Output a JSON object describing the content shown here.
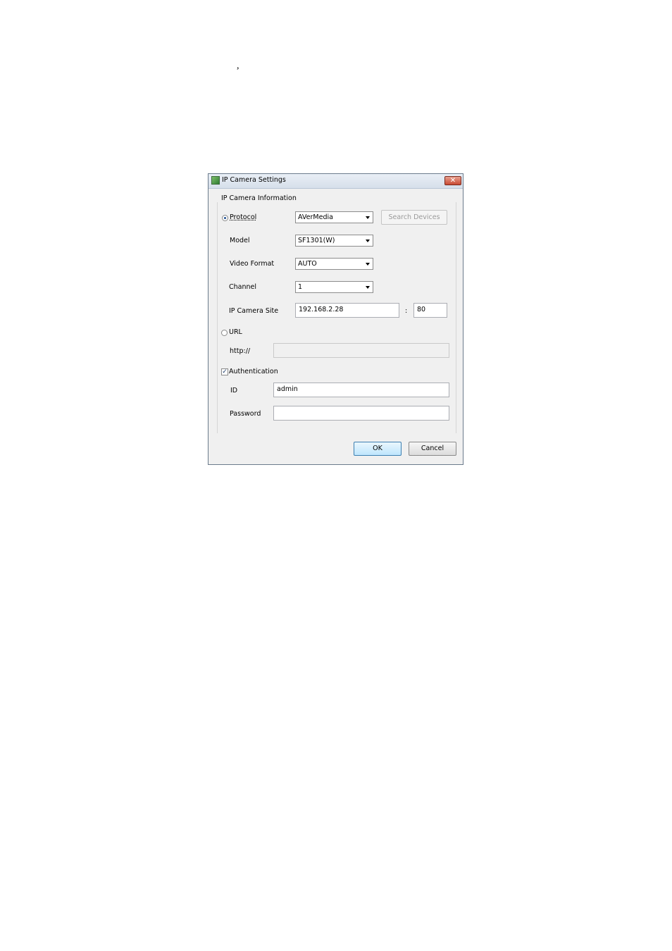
{
  "page": {
    "stray_mark": ","
  },
  "dialog": {
    "title": "IP Camera Settings",
    "close_label": "✕",
    "group_label": "IP Camera Information",
    "protocol": {
      "label": "Protocol",
      "selected": true,
      "value": "AVerMedia"
    },
    "search_devices_label": "Search Devices",
    "model": {
      "label": "Model",
      "value": "SF1301(W)"
    },
    "video_format": {
      "label": "Video Format",
      "value": "AUTO"
    },
    "channel": {
      "label": "Channel",
      "value": "1"
    },
    "ip_site": {
      "label": "IP Camera Site",
      "value": "192.168.2.28",
      "separator": ":",
      "port": "80"
    },
    "url": {
      "label": "URL",
      "selected": false,
      "prefix": "http://",
      "value": ""
    },
    "authentication": {
      "label": "Authentication",
      "checked": true,
      "check_mark": "✓"
    },
    "id": {
      "label": "ID",
      "value": "admin"
    },
    "password": {
      "label": "Password",
      "value": ""
    },
    "ok_label": "OK",
    "cancel_label": "Cancel"
  }
}
